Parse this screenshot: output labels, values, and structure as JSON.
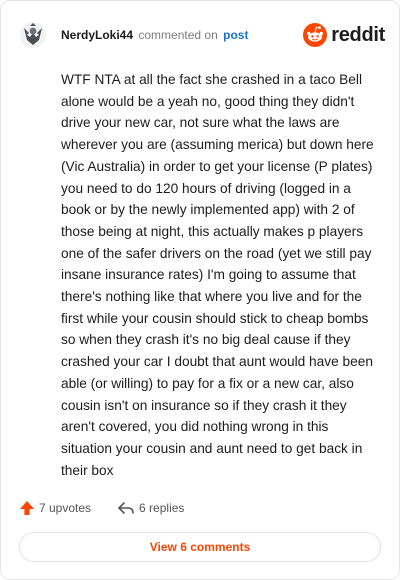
{
  "comment": {
    "username": "NerdyLoki44",
    "action_text": "commented on",
    "post_link_text": "post",
    "brand_name": "reddit",
    "body": "WTF NTA at all the fact she crashed in a taco Bell alone would be a yeah no, good thing they didn't drive your new car, not sure what the laws are wherever you are (assuming merica) but down here (Vic Australia) in order to get your license (P plates) you need to do 120 hours of driving (logged in a book or by the newly implemented app) with 2 of those being at night, this actually makes p players one of the safer drivers on the road (yet we still pay insane insurance rates) I'm going to assume that there's nothing like that where you live and for the first while your cousin should stick to cheap bombs so when they crash it's no big deal cause if they crashed your car I doubt that aunt would have been able (or willing) to pay for a fix or a new car, also cousin isn't on insurance so if they crash it they aren't covered, you did nothing wrong in this situation your cousin and aunt need to get back in their box",
    "upvotes_label": "7 upvotes",
    "replies_label": "6 replies",
    "view_comments_label": "View 6 comments"
  },
  "colors": {
    "brand_orange": "#ff4500",
    "link_blue": "#1a73c8",
    "text": "#1c1c1c",
    "muted": "#7c7c7c"
  },
  "icons": {
    "avatar": "snoo-avatar-icon",
    "brand": "reddit-logo-icon",
    "upvote": "upvote-arrow-icon",
    "reply": "reply-arrow-icon"
  }
}
